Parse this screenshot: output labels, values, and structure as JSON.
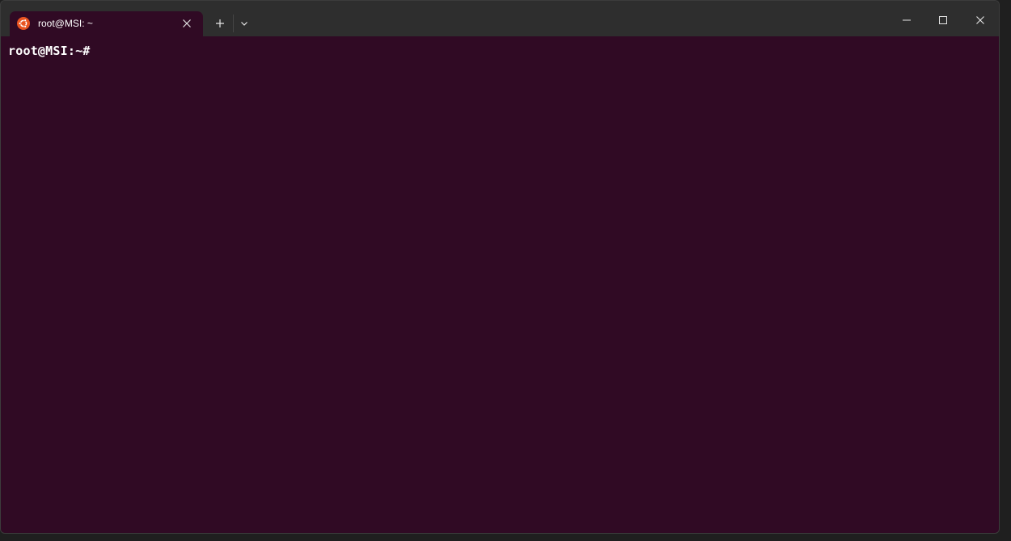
{
  "window": {
    "tab": {
      "title": "root@MSI: ~",
      "icon": "ubuntu-icon",
      "accent": "#e95420"
    },
    "controls": {
      "new_tab_icon": "plus-icon",
      "dropdown_icon": "chevron-down-icon",
      "minimize_icon": "minimize-icon",
      "maximize_icon": "maximize-icon",
      "close_icon": "close-icon"
    }
  },
  "terminal": {
    "prompt": "root@MSI:~#",
    "background": "#300a24"
  }
}
